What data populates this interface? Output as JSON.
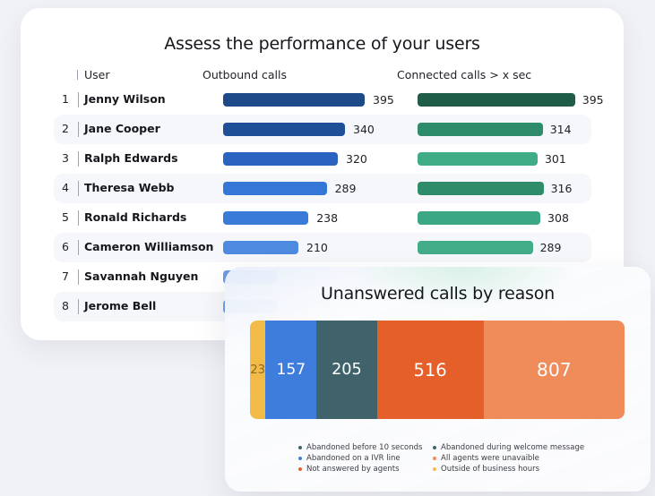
{
  "performance_card": {
    "title": "Assess the performance of your users",
    "columns": {
      "user": "User",
      "outbound": "Outbound calls",
      "connected": "Connected calls > x sec"
    },
    "rows": [
      {
        "index": "1",
        "name": "Jenny Wilson",
        "outbound": 395,
        "connected": 395,
        "outbound_color": "#1f4a8a",
        "connected_color": "#1f5d49"
      },
      {
        "index": "2",
        "name": "Jane Cooper",
        "outbound": 340,
        "connected": 314,
        "outbound_color": "#1f4f97",
        "connected_color": "#2f8c6b"
      },
      {
        "index": "3",
        "name": "Ralph Edwards",
        "outbound": 320,
        "connected": 301,
        "outbound_color": "#2a63c0",
        "connected_color": "#40ad87"
      },
      {
        "index": "4",
        "name": "Theresa Webb",
        "outbound": 289,
        "connected": 316,
        "outbound_color": "#3477d6",
        "connected_color": "#2f8c6b"
      },
      {
        "index": "5",
        "name": "Ronald Richards",
        "outbound": 238,
        "connected": 308,
        "outbound_color": "#3a7bd8",
        "connected_color": "#3ca784"
      },
      {
        "index": "6",
        "name": "Cameron Williamson",
        "outbound": 210,
        "connected": 289,
        "outbound_color": "#4d8ae0",
        "connected_color": "#43ad8a"
      },
      {
        "index": "7",
        "name": "Savannah Nguyen",
        "outbound": null,
        "connected": null,
        "outbound_color": "#6a9be3",
        "connected_color": "#43ad8a"
      },
      {
        "index": "8",
        "name": "Jerome Bell",
        "outbound": null,
        "connected": null,
        "outbound_color": "#6e9fe3",
        "connected_color": "#43ad8a"
      }
    ]
  },
  "unanswered_card": {
    "title": "Unanswered calls by reason"
  },
  "chart_data": [
    {
      "type": "bar",
      "orientation": "horizontal",
      "title": "Assess the performance of your users",
      "categories": [
        "Jenny Wilson",
        "Jane Cooper",
        "Ralph Edwards",
        "Theresa Webb",
        "Ronald Richards",
        "Cameron Williamson",
        "Savannah Nguyen",
        "Jerome Bell"
      ],
      "series": [
        {
          "name": "Outbound calls",
          "values": [
            395,
            340,
            320,
            289,
            238,
            210,
            null,
            null
          ]
        },
        {
          "name": "Connected calls > x sec",
          "values": [
            395,
            314,
            301,
            316,
            308,
            289,
            null,
            null
          ]
        }
      ],
      "note": "Values for rows 7 and 8 are occluded by the overlapping card"
    },
    {
      "type": "bar",
      "orientation": "stacked-horizontal",
      "title": "Unanswered calls by reason",
      "segments": [
        {
          "label": "Outside of business hours",
          "value": 23,
          "color": "#f2bb48",
          "text_color": "#8a6a25"
        },
        {
          "label": "Abandoned on a IVR line",
          "value": 157,
          "color": "#3f7ddc",
          "text_color": "#ffffff"
        },
        {
          "label": "Abandoned before 10 seconds",
          "value": 205,
          "color": "#3f626b",
          "text_color": "#ffffff"
        },
        {
          "label": "Not answered by agents",
          "value": 516,
          "color": "#e55f2a",
          "text_color": "#ffffff"
        },
        {
          "label": "All agents were unavaible",
          "value": 807,
          "color": "#ef8c5a",
          "text_color": "#ffffff"
        }
      ],
      "legend": [
        {
          "label": "Abandoned before 10 seconds",
          "color": "#3f626b"
        },
        {
          "label": "Abandoned during welcome message",
          "color": "#3f626b"
        },
        {
          "label": "Abandoned on a IVR line",
          "color": "#3f7ddc"
        },
        {
          "label": "All agents were unavaible",
          "color": "#ef8c5a"
        },
        {
          "label": "Not answered by agents",
          "color": "#e55f2a"
        },
        {
          "label": "Outside of business hours",
          "color": "#f2bb48"
        }
      ],
      "legend_position": "bottom"
    }
  ]
}
